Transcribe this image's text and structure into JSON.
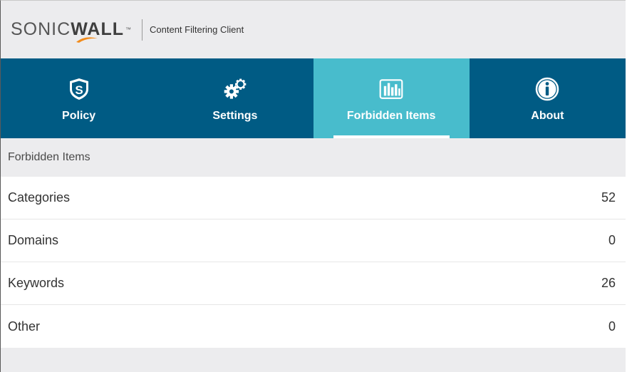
{
  "header": {
    "logo_light": "SONIC",
    "logo_bold": "WALL",
    "logo_tm": "™",
    "app_name": "Content Filtering Client"
  },
  "nav": {
    "tabs": [
      {
        "label": "Policy",
        "icon": "shield-s-icon",
        "active": false
      },
      {
        "label": "Settings",
        "icon": "gears-icon",
        "active": false
      },
      {
        "label": "Forbidden Items",
        "icon": "bar-chart-icon",
        "active": true
      },
      {
        "label": "About",
        "icon": "info-icon",
        "active": false
      }
    ]
  },
  "section": {
    "title": "Forbidden Items",
    "items": [
      {
        "label": "Categories",
        "count": "52"
      },
      {
        "label": "Domains",
        "count": "0"
      },
      {
        "label": "Keywords",
        "count": "26"
      },
      {
        "label": "Other",
        "count": "0"
      }
    ]
  },
  "colors": {
    "nav_bg": "#005b84",
    "active_tab": "#48bccc",
    "swoosh": "#f28c1c"
  }
}
